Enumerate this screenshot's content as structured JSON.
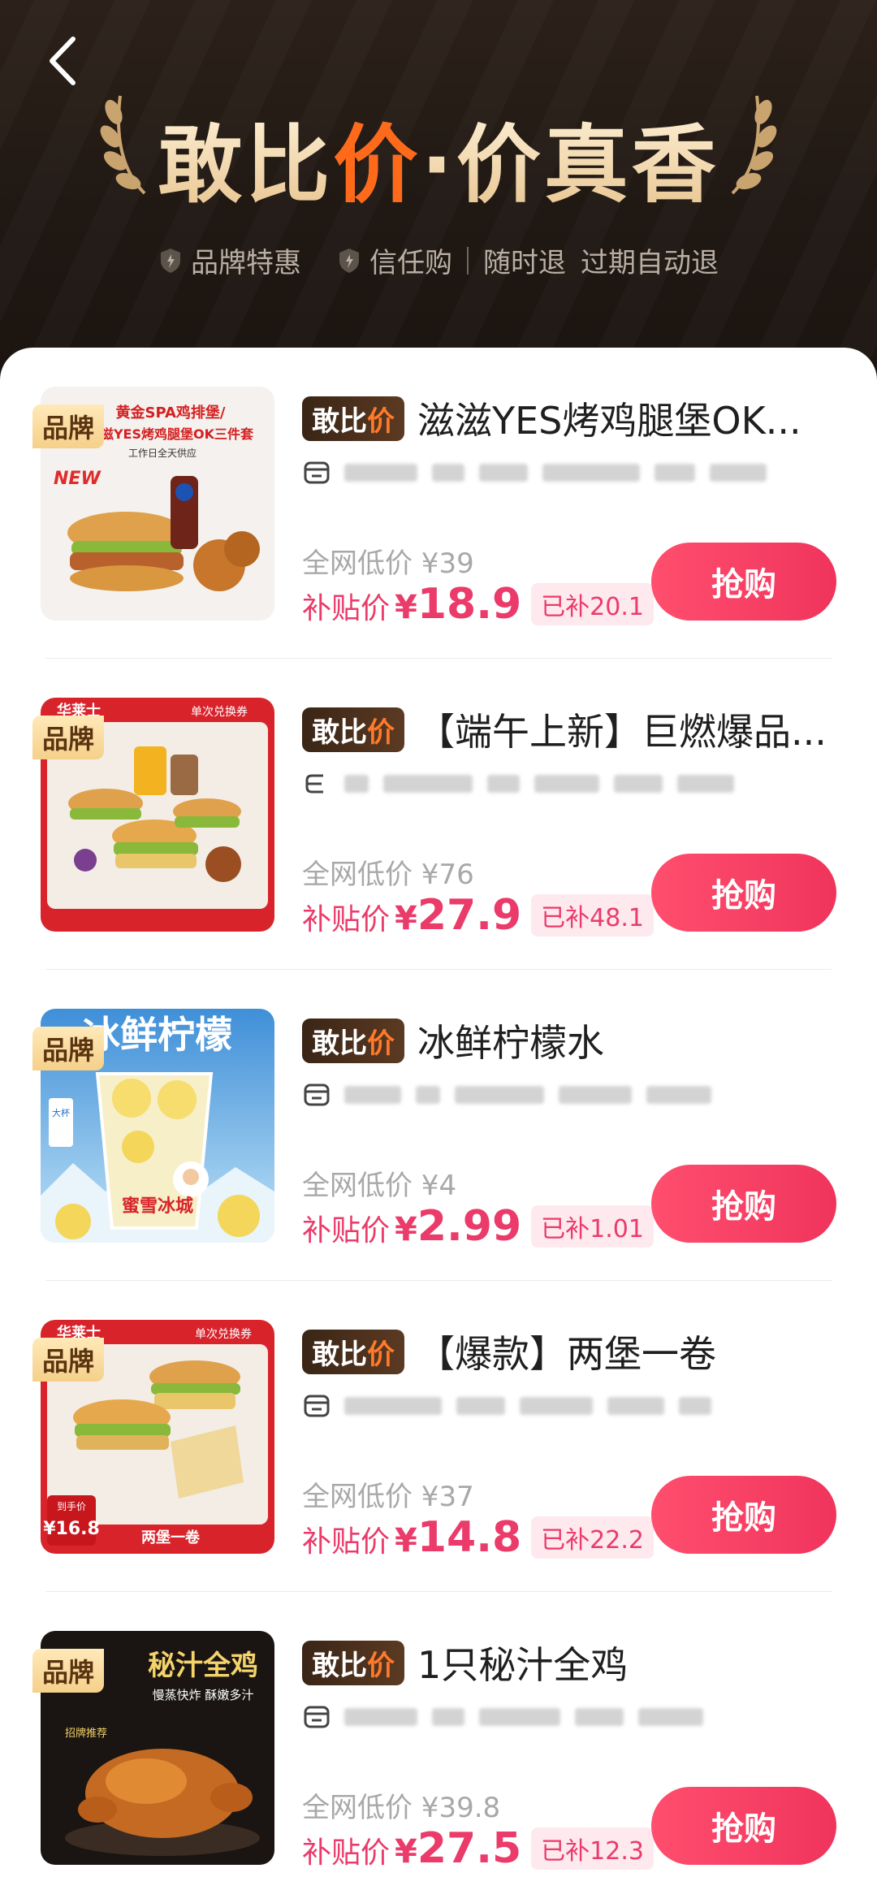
{
  "header": {
    "back_icon": "chevron-left-icon",
    "title_part1": "敢比",
    "title_bolt": "价",
    "title_part2": "·价真香",
    "badges": [
      {
        "icon": "shield-icon",
        "label": "品牌特惠"
      },
      {
        "icon": "shield-icon",
        "label": "信任购"
      }
    ],
    "guarantee_1": "随时退",
    "guarantee_2": "过期自动退"
  },
  "labels": {
    "gbj_part1": "敢比",
    "gbj_bolt": "价",
    "pin_tag": "品牌",
    "price_label": "补贴价",
    "yen": "¥",
    "buy_label": "抢购"
  },
  "items": [
    {
      "name": "滋滋YES烤鸡腿堡OK...",
      "original": "全网低价 ¥39",
      "price": "18.9",
      "subsidy": "已补20.1",
      "thumb_text_1": "黄金SPA鸡排堡/",
      "thumb_text_2": "滋滋YES烤鸡腿堡OK三件套",
      "thumb_text_3": "工作日全天供应",
      "thumb_badge": "NEW"
    },
    {
      "name": "【端午上新】巨燃爆品...",
      "original": "全网低价 ¥76",
      "price": "27.9",
      "subsidy": "已补48.1",
      "thumb_text_1": "华莱士",
      "thumb_text_2": "单次兑换券"
    },
    {
      "name": "冰鲜柠檬水",
      "original": "全网低价 ¥4",
      "price": "2.99",
      "subsidy": "已补1.01",
      "thumb_text_1": "冰鲜柠檬",
      "thumb_text_2": "蜜雪冰城",
      "thumb_text_3": "大杯"
    },
    {
      "name": "【爆款】两堡一卷",
      "original": "全网低价 ¥37",
      "price": "14.8",
      "subsidy": "已补22.2",
      "thumb_text_1": "华莱士",
      "thumb_text_2": "单次兑换券",
      "thumb_text_3": "两堡一卷",
      "thumb_text_4": "到手价",
      "thumb_text_5": "¥16.8"
    },
    {
      "name": "1只秘汁全鸡",
      "original": "全网低价 ¥39.8",
      "price": "27.5",
      "subsidy": "已补12.3",
      "thumb_text_1": "秘汁全鸡",
      "thumb_text_2": "慢蒸快炸 酥嫩多汁",
      "thumb_text_3": "招牌推荐"
    }
  ],
  "colors": {
    "accent": "#ea3b6a",
    "buy_button": "#f0345c",
    "header_bg": "#201813",
    "title_gold": "#f4dfb9"
  }
}
